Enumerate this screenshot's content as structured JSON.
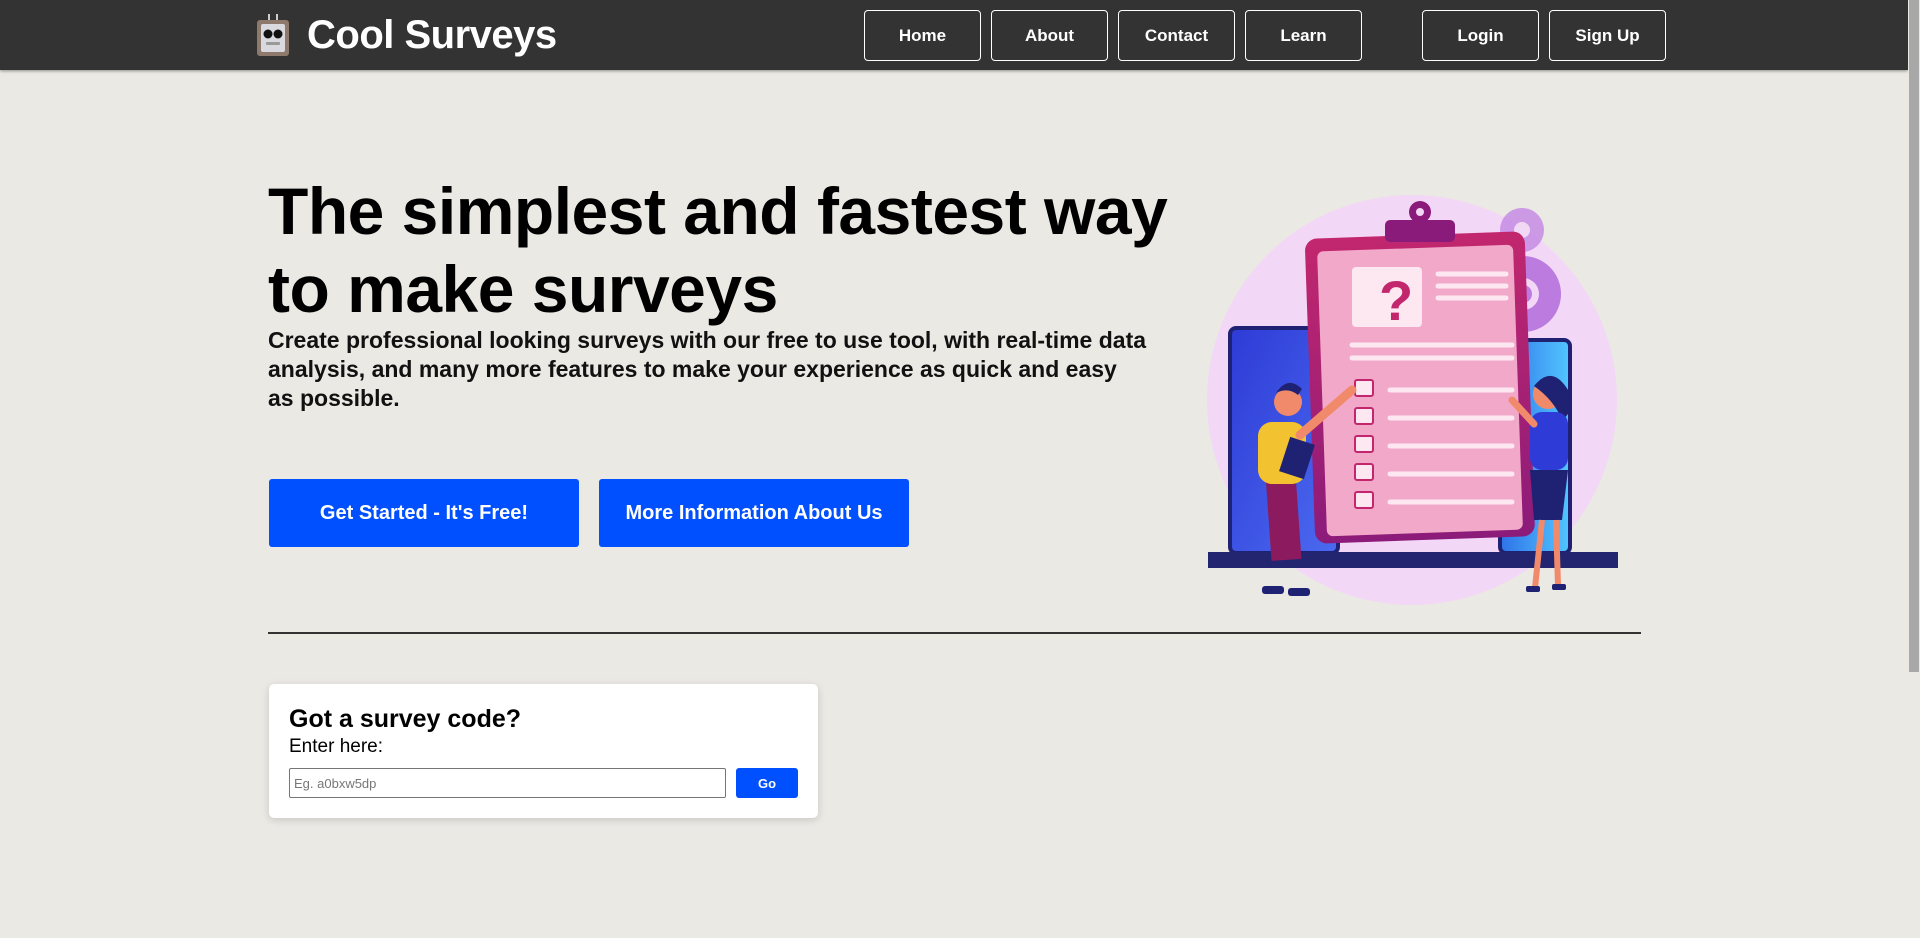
{
  "header": {
    "brand": "Cool Surveys",
    "nav": {
      "home": "Home",
      "about": "About",
      "contact": "Contact",
      "learn": "Learn",
      "login": "Login",
      "signup": "Sign Up"
    }
  },
  "hero": {
    "title_line1": "The simplest and fastest way",
    "title_line2": "to make surveys",
    "subtitle": "Create professional looking surveys with our free to use tool, with real-time data analysis, and many more features to make your experience as quick and easy as possible.",
    "primary_cta": "Get Started - It's Free!",
    "secondary_cta": "More Information About Us",
    "illustration_mark": "?"
  },
  "survey_code": {
    "title": "Got a survey code?",
    "label": "Enter here:",
    "placeholder": "Eg. a0bxw5dp",
    "submit": "Go"
  },
  "icons": {
    "logo": "robot-clipboard-logo-icon",
    "illustration": "survey-clipboard-illustration"
  },
  "colors": {
    "header_bg": "#333333",
    "page_bg": "#ebe9e4",
    "accent": "#0050ff",
    "card_bg": "#ffffff"
  }
}
